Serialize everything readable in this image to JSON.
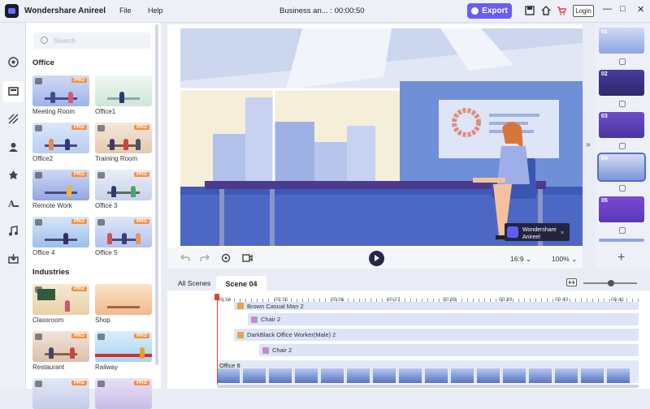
{
  "app": {
    "name": "Wondershare Anireel",
    "menu": [
      "File",
      "Help"
    ],
    "title": "Business an... : 00:00:50",
    "export_label": "Export",
    "login_label": "Login"
  },
  "library": {
    "search_placeholder": "Search",
    "sections": [
      {
        "title": "Office",
        "items": [
          {
            "label": "Meeting Room",
            "pro": true
          },
          {
            "label": "Office1",
            "pro": false
          },
          {
            "label": "Office2",
            "pro": true
          },
          {
            "label": "Training Room",
            "pro": true
          },
          {
            "label": "Remote Work",
            "pro": true
          },
          {
            "label": "Office 3",
            "pro": true
          },
          {
            "label": "Office 4",
            "pro": true
          },
          {
            "label": "Office 5",
            "pro": true
          }
        ]
      },
      {
        "title": "Industries",
        "items": [
          {
            "label": "Classroom",
            "pro": true
          },
          {
            "label": "Shop",
            "pro": false
          },
          {
            "label": "Restaurant",
            "pro": true
          },
          {
            "label": "Railway",
            "pro": true
          }
        ]
      }
    ],
    "pro_badge": "PRO"
  },
  "preview": {
    "watermark_line1": "Wondershare",
    "watermark_line2": "Anireel",
    "aspect": "16:9",
    "zoom": "100%"
  },
  "scene_list": {
    "numbers": [
      "01",
      "02",
      "03",
      "04",
      "05"
    ],
    "selected_index": 3
  },
  "timeline": {
    "tabs": [
      "All Scenes",
      "Scene 04"
    ],
    "active_tab": "Scene 04",
    "ticks": [
      "00:34",
      "00:35",
      "00:36",
      "00:37",
      "00:38",
      "00:39",
      "00:40",
      "00:41"
    ],
    "tracks": [
      {
        "label": "Brown Casual Man 2",
        "icon": "person"
      },
      {
        "label": "Chair 2",
        "icon": "prop"
      },
      {
        "label": "DarkBlack Office Worker(Male) 2",
        "icon": "person"
      },
      {
        "label": "Chair 2",
        "icon": "prop"
      }
    ],
    "background_track": "Office 8"
  },
  "colors": {
    "accent": "#6a5cf5",
    "pro": "#f7913d",
    "playhead": "#e5403a"
  }
}
